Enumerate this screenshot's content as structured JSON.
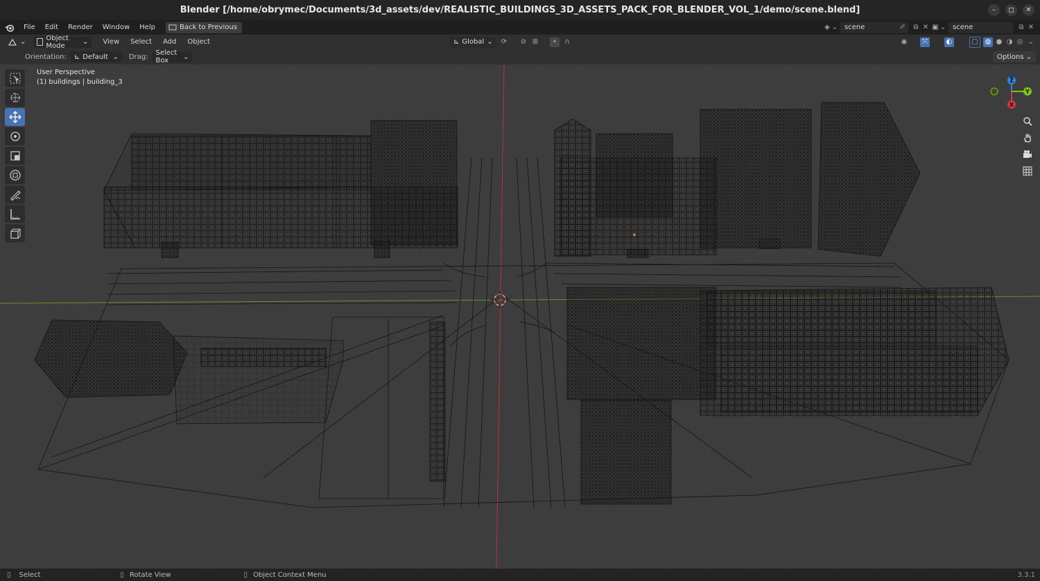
{
  "window": {
    "title": "Blender [/home/obrymec/Documents/3d_assets/dev/REALISTIC_BUILDINGS_3D_ASSETS_PACK_FOR_BLENDER_VOL_1/demo/scene.blend]"
  },
  "topbar": {
    "menus": [
      "File",
      "Edit",
      "Render",
      "Window",
      "Help"
    ],
    "back_label": "Back to Previous",
    "scene_name": "scene",
    "view_layer_name": "scene"
  },
  "header": {
    "mode": "Object Mode",
    "menus": [
      "View",
      "Select",
      "Add",
      "Object"
    ],
    "transform_orientation": "Global"
  },
  "tool_header": {
    "orientation_label": "Orientation:",
    "orientation_value": "Default",
    "drag_label": "Drag:",
    "drag_value": "Select Box",
    "options_label": "Options"
  },
  "viewport": {
    "perspective_label": "User Perspective",
    "object_label": "(1) buildings | building_3"
  },
  "gizmo": {
    "z": "Z",
    "y": "Y",
    "x": "X"
  },
  "statusbar": {
    "select": "Select",
    "rotate": "Rotate View",
    "context": "Object Context Menu",
    "version": "3.3.1"
  },
  "colors": {
    "active_tool": "#4772b3",
    "x_axis": "#d8363f",
    "y_axis": "#7ec318",
    "z_axis": "#2f83e0",
    "wireframe": "#111111"
  },
  "icons": [
    "blender-logo-icon",
    "cursor-select-icon",
    "cursor-icon",
    "move-icon",
    "rotate-icon",
    "scale-icon",
    "transform-icon",
    "annotate-icon",
    "measure-icon",
    "add-cube-icon",
    "zoom-icon",
    "hand-icon",
    "camera-icon",
    "grid-icon"
  ]
}
